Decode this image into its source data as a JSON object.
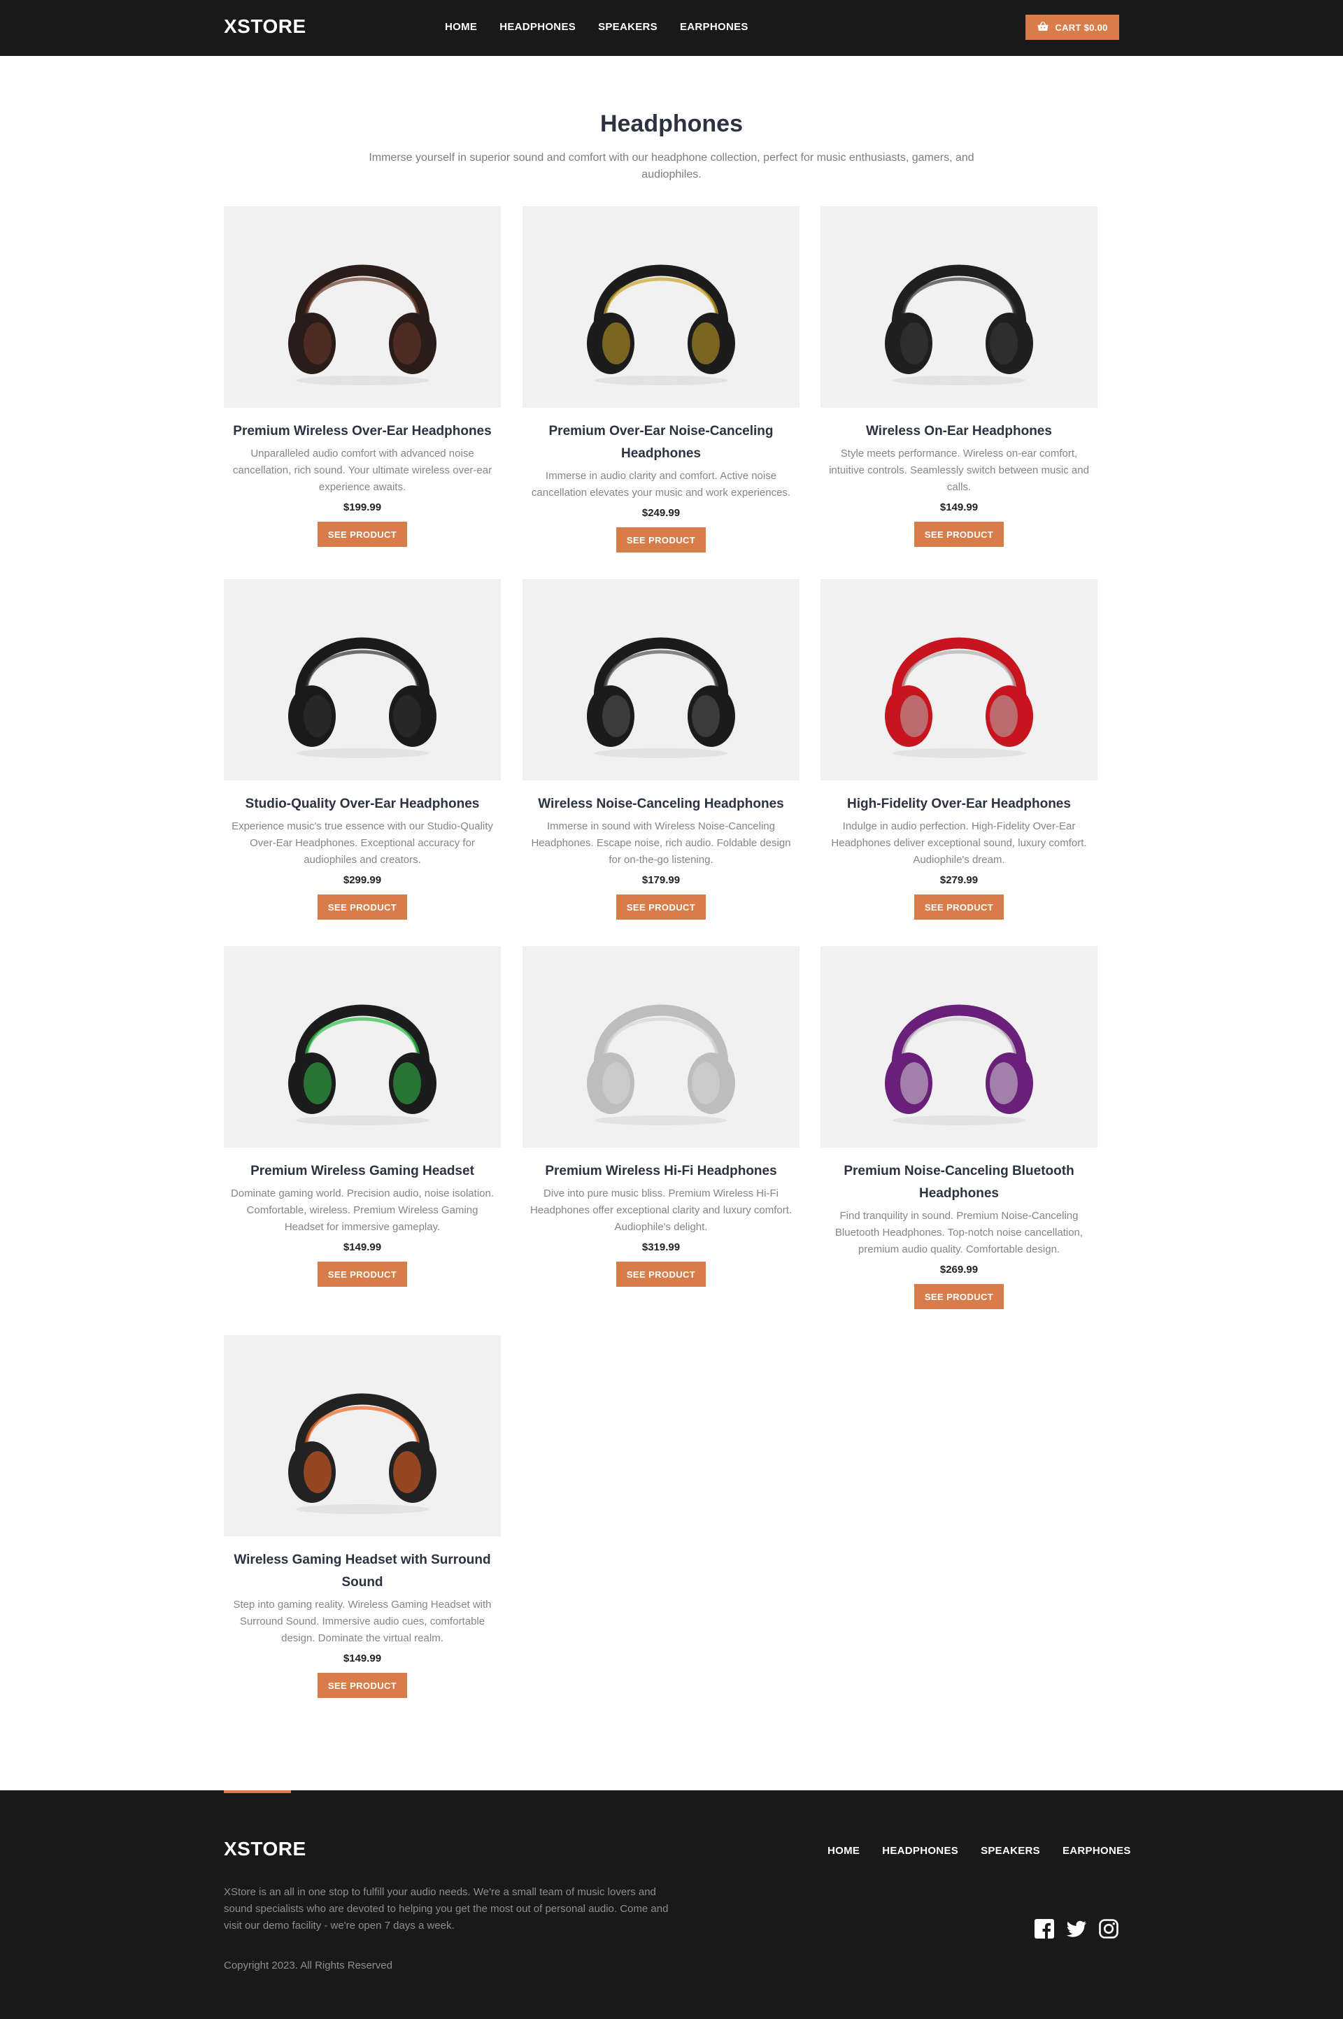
{
  "header": {
    "brand": "XSTORE",
    "nav": [
      "HOME",
      "HEADPHONES",
      "SPEAKERS",
      "EARPHONES"
    ],
    "cart_label": "CART $0.00"
  },
  "page": {
    "title": "Headphones",
    "subtitle": "Immerse yourself in superior sound and comfort with our headphone collection, perfect for music enthusiasts, gamers, and audiophiles."
  },
  "products": [
    {
      "name": "Premium Wireless Over-Ear Headphones",
      "desc": "Unparalleled audio comfort with advanced noise cancellation, rich sound. Your ultimate wireless over-ear experience awaits.",
      "price": "$199.99",
      "button": "SEE PRODUCT",
      "color": "#2a1c18",
      "accent": "#6b3a2a"
    },
    {
      "name": "Premium Over-Ear Noise-Canceling Headphones",
      "desc": "Immerse in audio clarity and comfort. Active noise cancellation elevates your music and work experiences.",
      "price": "$249.99",
      "button": "SEE PRODUCT",
      "color": "#1c1c1c",
      "accent": "#c9a227"
    },
    {
      "name": "Wireless On-Ear Headphones",
      "desc": "Style meets performance. Wireless on-ear comfort, intuitive controls. Seamlessly switch between music and calls.",
      "price": "$149.99",
      "button": "SEE PRODUCT",
      "color": "#1f1f1f",
      "accent": "#3a3a3a"
    },
    {
      "name": "Studio-Quality Over-Ear Headphones",
      "desc": "Experience music's true essence with our Studio-Quality Over-Ear Headphones. Exceptional accuracy for audiophiles and creators.",
      "price": "$299.99",
      "button": "SEE PRODUCT",
      "color": "#1a1a1a",
      "accent": "#333333"
    },
    {
      "name": "Wireless Noise-Canceling Headphones",
      "desc": "Immerse in sound with Wireless Noise-Canceling Headphones. Escape noise, rich audio. Foldable design for on-the-go listening.",
      "price": "$179.99",
      "button": "SEE PRODUCT",
      "color": "#1b1b1b",
      "accent": "#555555"
    },
    {
      "name": "High-Fidelity Over-Ear Headphones",
      "desc": "Indulge in audio perfection. High-Fidelity Over-Ear Headphones deliver exceptional sound, luxury comfort. Audiophile's dream.",
      "price": "$279.99",
      "button": "SEE PRODUCT",
      "color": "#c8141e",
      "accent": "#b0b0b0"
    },
    {
      "name": "Premium Wireless Gaming Headset",
      "desc": "Dominate gaming world. Precision audio, noise isolation. Comfortable, wireless. Premium Wireless Gaming Headset for immersive gameplay.",
      "price": "$149.99",
      "button": "SEE PRODUCT",
      "color": "#1c1c1c",
      "accent": "#2fbf4a"
    },
    {
      "name": "Premium Wireless Hi-Fi Headphones",
      "desc": "Dive into pure music bliss. Premium Wireless Hi-Fi Headphones offer exceptional clarity and luxury comfort. Audiophile's delight.",
      "price": "$319.99",
      "button": "SEE PRODUCT",
      "color": "#bdbdbd",
      "accent": "#d6d6d6"
    },
    {
      "name": "Premium Noise-Canceling Bluetooth Headphones",
      "desc": "Find tranquility in sound. Premium Noise-Canceling Bluetooth Headphones. Top-notch noise cancellation, premium audio quality. Comfortable design.",
      "price": "$269.99",
      "button": "SEE PRODUCT",
      "color": "#6a1f7a",
      "accent": "#cfcfcf"
    },
    {
      "name": "Wireless Gaming Headset with Surround Sound",
      "desc": "Step into gaming reality. Wireless Gaming Headset with Surround Sound. Immersive audio cues, comfortable design. Dominate the virtual realm.",
      "price": "$149.99",
      "button": "SEE PRODUCT",
      "color": "#222222",
      "accent": "#f06420"
    }
  ],
  "footer": {
    "brand": "XSTORE",
    "nav": [
      "HOME",
      "HEADPHONES",
      "SPEAKERS",
      "EARPHONES"
    ],
    "about": "XStore is an all in one stop to fulfill your audio needs. We're a small team of music lovers and sound specialists who are devoted to helping you get the most out of personal audio. Come and visit our demo facility - we're open 7 days a week.",
    "copyright": "Copyright 2023. All Rights Reserved",
    "socials": [
      "facebook-icon",
      "twitter-icon",
      "instagram-icon"
    ]
  },
  "colors": {
    "accent": "#d87d4a",
    "dark": "#191919",
    "card_bg": "#f1f1f1"
  }
}
